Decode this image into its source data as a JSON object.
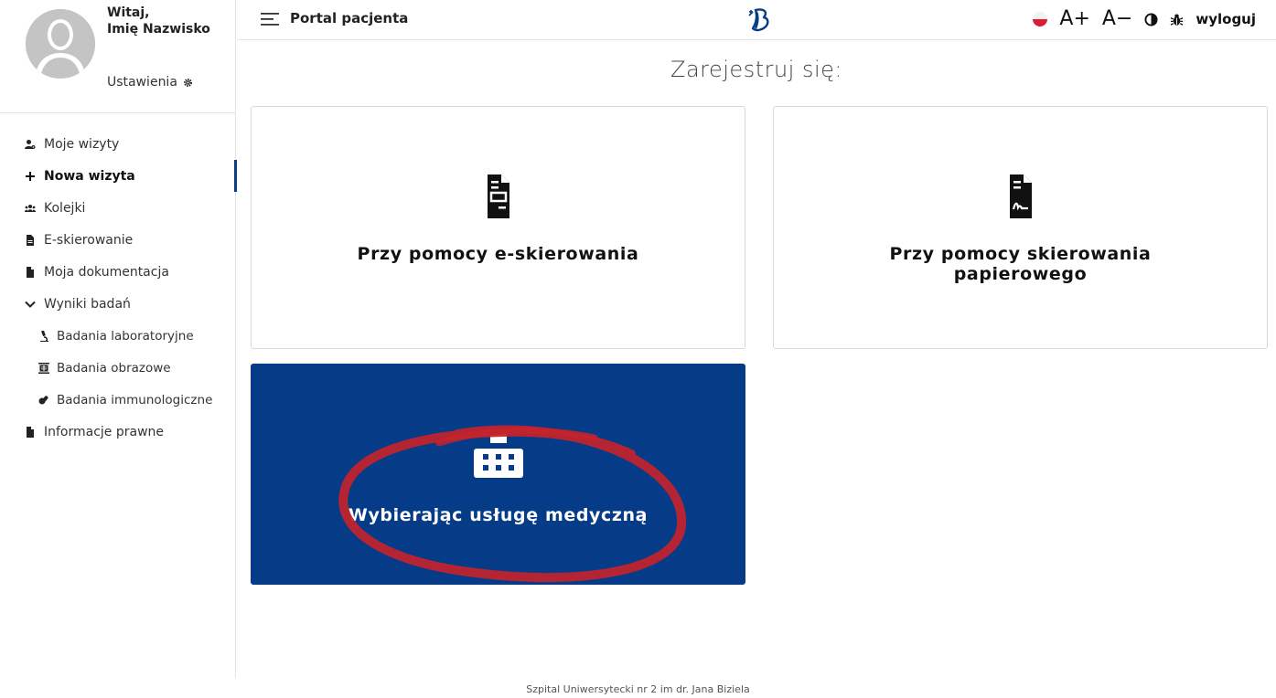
{
  "user": {
    "greeting": "Witaj,",
    "name": "Imię Nazwisko",
    "settings_label": "Ustawienia"
  },
  "nav": {
    "items": [
      {
        "label": "Moje wizyty",
        "icon": "user-gear-icon"
      },
      {
        "label": "Nowa wizyta",
        "icon": "plus-icon",
        "active": true
      },
      {
        "label": "Kolejki",
        "icon": "users-icon"
      },
      {
        "label": "E-skierowanie",
        "icon": "file-icon"
      },
      {
        "label": "Moja dokumentacja",
        "icon": "file-icon"
      },
      {
        "label": "Wyniki badań",
        "icon": "chevron-down-icon",
        "expanded": true
      },
      {
        "label": "Badania laboratoryjne",
        "icon": "microscope-icon",
        "sub": true
      },
      {
        "label": "Badania obrazowe",
        "icon": "xray-icon",
        "sub": true
      },
      {
        "label": "Badania immunologiczne",
        "icon": "pills-icon",
        "sub": true
      },
      {
        "label": "Informacje prawne",
        "icon": "file-icon"
      }
    ]
  },
  "topbar": {
    "title": "Portal pacjenta",
    "font_increase": "A+",
    "font_decrease": "A−",
    "logout_label": "wyloguj"
  },
  "main": {
    "heading": "Zarejestruj się:",
    "cards": [
      {
        "label": "Przy pomocy e-skierowania",
        "icon": "file-lines-icon"
      },
      {
        "label": "Przy pomocy skierowania papierowego",
        "icon": "file-signature-icon"
      },
      {
        "label": "Wybierając usługę medyczną",
        "icon": "hospital-icon"
      }
    ]
  },
  "footer": {
    "text": "Szpital Uniwersytecki nr 2 im dr. Jana Biziela"
  },
  "colors": {
    "primary": "#063c87",
    "annotation": "#c4232b",
    "flag_red": "#d91e36"
  }
}
